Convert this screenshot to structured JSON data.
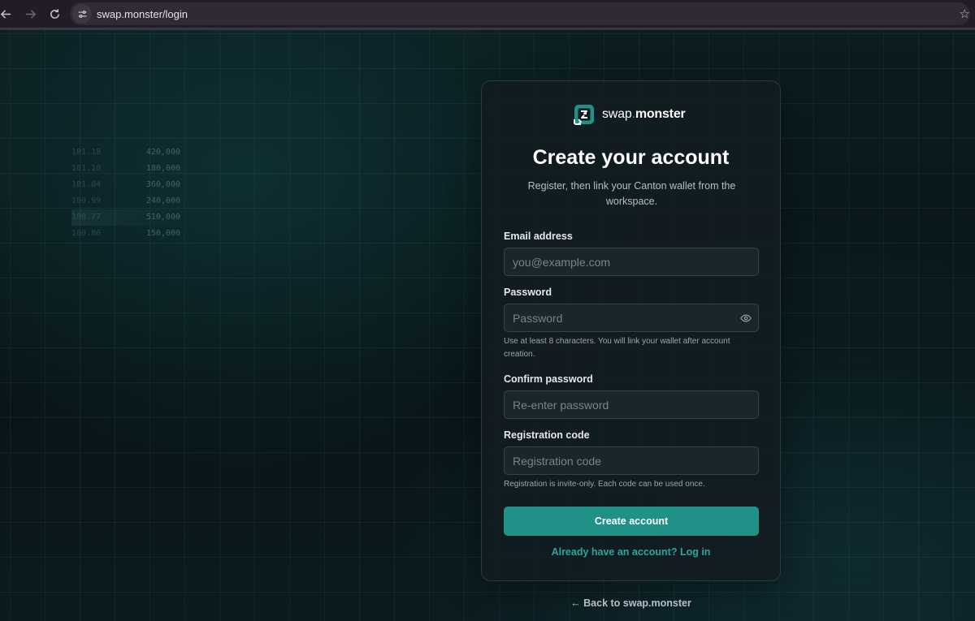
{
  "browser": {
    "url": "swap.monster/login",
    "back_icon": "arrow-left-icon",
    "forward_icon": "arrow-right-icon",
    "reload_icon": "reload-icon",
    "site_info_icon": "tune-icon",
    "bookmark_icon": "star-icon",
    "star_glyph": "☆"
  },
  "background": {
    "ticker": [
      {
        "price": "101.18",
        "volume": "420,000"
      },
      {
        "price": "101.10",
        "volume": "180,000"
      },
      {
        "price": "101.04",
        "volume": "360,000"
      },
      {
        "price": "100.99",
        "volume": "240,000"
      },
      {
        "price": "100.77",
        "volume": "510,000"
      },
      {
        "price": "100.86",
        "volume": "150,000"
      }
    ]
  },
  "brand": {
    "name_part1": "swap",
    "name_dot": ".",
    "name_part2": "monster",
    "logo_icon": "swap-logo-icon"
  },
  "form": {
    "title": "Create your account",
    "subtitle": "Register, then link your Canton wallet from the workspace.",
    "email": {
      "label": "Email address",
      "placeholder": "you@example.com",
      "value": ""
    },
    "password": {
      "label": "Password",
      "placeholder": "Password",
      "value": "",
      "hint": "Use at least 8 characters. You will link your wallet after account creation.",
      "toggle_icon": "eye-icon"
    },
    "confirm_password": {
      "label": "Confirm password",
      "placeholder": "Re-enter password",
      "value": ""
    },
    "registration_code": {
      "label": "Registration code",
      "placeholder": "Registration code",
      "value": "",
      "hint": "Registration is invite-only. Each code can be used once."
    },
    "submit_label": "Create account",
    "login_link": "Already have an account? Log in"
  },
  "footer": {
    "back_link": "← Back to swap.monster"
  },
  "colors": {
    "accent": "#1f9187",
    "accent_text": "#2aa79b",
    "card_bg": "#121c21",
    "page_bg": "#0a1418"
  }
}
